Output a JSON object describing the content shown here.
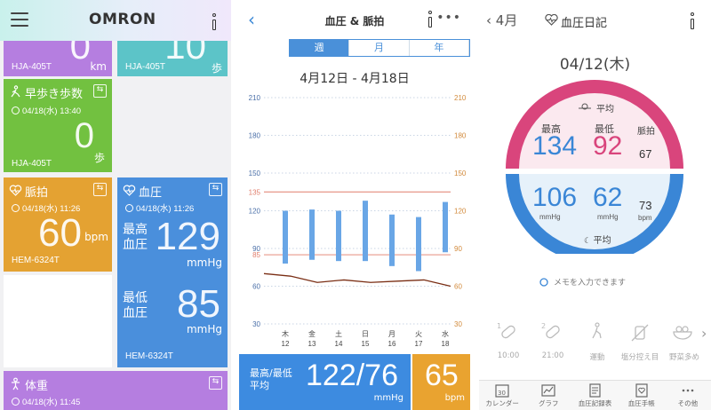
{
  "panel1": {
    "brand": "OMRON",
    "tile_steps": {
      "value": "0",
      "unit": "km",
      "device": "HJA-405T"
    },
    "tile_dist": {
      "value": "10",
      "unit": "歩",
      "device": "HJA-405T"
    },
    "tile_brisk": {
      "title": "早歩き歩数",
      "date": "04/18(水) 13:40",
      "value": "0",
      "unit": "歩",
      "device": "HJA-405T"
    },
    "tile_pulse": {
      "title": "脈拍",
      "date": "04/18(水) 11:26",
      "value": "60",
      "unit": "bpm",
      "device": "HEM-6324T"
    },
    "tile_bp": {
      "title": "血圧",
      "date": "04/18(水) 11:26",
      "sys_label_1": "最高",
      "sys_label_2": "血圧",
      "sys_value": "129",
      "sys_unit": "mmHg",
      "dia_label_1": "最低",
      "dia_label_2": "血圧",
      "dia_value": "85",
      "dia_unit": "mmHg",
      "device": "HEM-6324T"
    },
    "tile_weight": {
      "title": "体重",
      "date": "04/18(水) 11:45"
    },
    "colors": {
      "purple": "#b57ee0",
      "teal": "#5cc4c8",
      "green": "#72c140",
      "orange": "#e4a232",
      "blue": "#4a8fdc"
    }
  },
  "panel2": {
    "title": "血圧 & 脈拍",
    "tabs": [
      {
        "label": "週",
        "active": true
      },
      {
        "label": "月",
        "active": false
      },
      {
        "label": "年",
        "active": false
      }
    ],
    "range": "4月12日 - 4月18日",
    "footer": {
      "label_1": "最高/最低",
      "label_2": "平均",
      "value": "122/76",
      "unit": "mmHg",
      "pulse": "65",
      "pulse_unit": "bpm"
    }
  },
  "chart_data": {
    "type": "bar",
    "categories": [
      "木 12",
      "金 13",
      "土 14",
      "日 15",
      "月 16",
      "火 17",
      "水 18"
    ],
    "x_days": [
      "木",
      "金",
      "土",
      "日",
      "月",
      "火",
      "水"
    ],
    "x_dates": [
      "12",
      "13",
      "14",
      "15",
      "16",
      "17",
      "18"
    ],
    "series": [
      {
        "kind": "range_bar",
        "high": [
          120,
          121,
          120,
          128,
          117,
          115,
          127
        ],
        "low": [
          78,
          81,
          80,
          80,
          76,
          72,
          87
        ]
      },
      {
        "kind": "line",
        "values": [
          70,
          68,
          63,
          65,
          63,
          64,
          65,
          60
        ]
      }
    ],
    "left_ticks": [
      "210",
      "180",
      "150",
      "135",
      "120",
      "90",
      "85",
      "60",
      "30"
    ],
    "right_ticks": [
      "210",
      "180",
      "150",
      "120",
      "90",
      "60",
      "30"
    ],
    "ylim": [
      30,
      210
    ],
    "reference_lines": [
      135,
      85
    ],
    "colors": {
      "bar": "#69a6e6",
      "line": "#7a2e14",
      "ref": "#e07d6b",
      "tick_left": "#4a6fa8",
      "tick_right": "#d28a3b"
    }
  },
  "panel3": {
    "back_label": "4月",
    "title": "血圧日記",
    "date": "04/12(木)",
    "top_avg_label": "平均",
    "labels": {
      "sys": "最高",
      "dia": "最低",
      "pulse": "脈拍"
    },
    "evening": {
      "sys": "134",
      "dia": "92",
      "pulse": "67"
    },
    "morning": {
      "sys": "106",
      "dia": "62",
      "pulse": "73"
    },
    "bottom_avg_label": "平均",
    "units": {
      "mmhg": "mmHg",
      "bpm": "bpm"
    },
    "memo_placeholder": "メモを入力できます",
    "categories": [
      {
        "label": "10:00",
        "badge": "1"
      },
      {
        "label": "21:00",
        "badge": "2"
      },
      {
        "label": "運動",
        "badge": ""
      },
      {
        "label": "塩分控え目",
        "badge": ""
      },
      {
        "label": "野菜多め",
        "badge": ""
      }
    ],
    "tabs": [
      "カレンダー",
      "グラフ",
      "血圧記録表",
      "血圧手帳",
      "その他"
    ],
    "calendar_num": "30",
    "colors": {
      "pink": "#d9457c",
      "pink_bg": "#fbe9ef",
      "blue": "#3a86d6",
      "blue_bg": "#e6f1fa"
    }
  }
}
